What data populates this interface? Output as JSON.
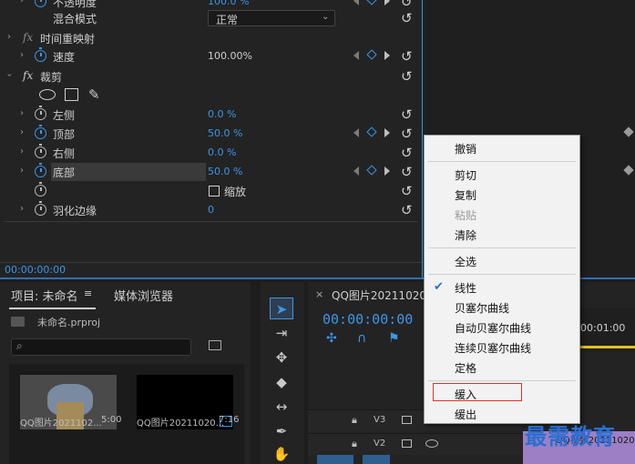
{
  "effect_controls": {
    "rows": [
      {
        "label": "不透明度",
        "value": "100.0 %"
      },
      {
        "label": "混合模式",
        "value": "正常"
      },
      {
        "label": "时间重映射"
      },
      {
        "label": "速度",
        "value": "100.00%"
      },
      {
        "label": "裁剪",
        "badge": "fx"
      },
      {
        "label": "左侧",
        "value": "0.0 %"
      },
      {
        "label": "顶部",
        "value": "50.0 %"
      },
      {
        "label": "右侧",
        "value": "0.0 %"
      },
      {
        "label": "底部",
        "value": "50.0 %"
      },
      {
        "label": "缩放"
      },
      {
        "label": "羽化边缘",
        "value": "0"
      }
    ],
    "timecode": "00:00:00:00"
  },
  "project": {
    "tab_project": "项目: 未命名",
    "tab_media": "媒体浏览器",
    "project_file": "未命名.prproj",
    "clips": [
      {
        "name": "QQ图片2021102...",
        "duration": "5:00"
      },
      {
        "name": "QQ图片20211020...",
        "duration": "7:16"
      }
    ]
  },
  "timeline": {
    "sequence_name": "QQ图片20211020",
    "timecode": "00:00:00:00",
    "ruler_time": "00:01:00",
    "tracks": [
      "V3",
      "V2"
    ],
    "clip_label": "QQ视频20211020"
  },
  "context_menu": {
    "items": [
      "撤销",
      "剪切",
      "复制",
      "粘贴",
      "清除",
      "全选",
      "线性",
      "贝塞尔曲线",
      "自动贝塞尔曲线",
      "连续贝塞尔曲线",
      "定格",
      "缓入",
      "缓出"
    ],
    "checked": "线性",
    "disabled": "粘贴",
    "highlighted": "缓入"
  },
  "watermark": "最需教育",
  "colors": {
    "accent": "#3d96e8",
    "menu_bg": "#f2f2f2",
    "highlight_box": "#d9342b"
  }
}
